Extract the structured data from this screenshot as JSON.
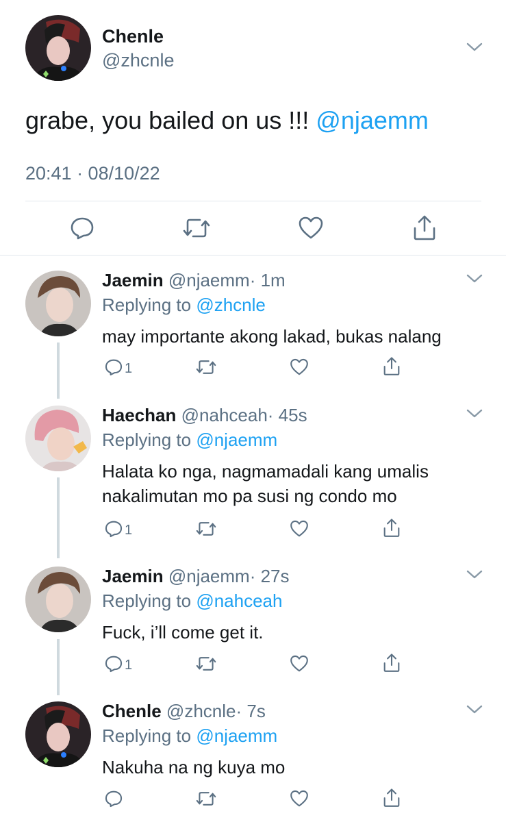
{
  "main_tweet": {
    "name": "Chenle",
    "handle": "@zhcnle",
    "text": "grabe, you bailed on us !!!",
    "mention": "@njaemm",
    "timestamp": "20:41 · 08/10/22"
  },
  "replies": [
    {
      "name": "Jaemin",
      "handle": "@njaemm",
      "time": "· 1m",
      "replying_prefix": "Replying to",
      "replying_to": "@zhcnle",
      "text_lines": [
        "may importante akong lakad, bukas nalang"
      ],
      "reply_count": "1"
    },
    {
      "name": "Haechan",
      "handle": "@nahceah",
      "time": "· 45s",
      "replying_prefix": "Replying to",
      "replying_to": "@njaemm",
      "text_lines": [
        "Halata ko nga, nagmamadali kang umalis",
        "nakalimutan mo pa susi ng condo mo"
      ],
      "reply_count": "1"
    },
    {
      "name": "Jaemin",
      "handle": "@njaemm",
      "time": "· 27s",
      "replying_prefix": "Replying to",
      "replying_to": "@nahceah",
      "text_lines": [
        "Fuck, i’ll come get it."
      ],
      "reply_count": "1"
    },
    {
      "name": "Chenle",
      "handle": "@zhcnle",
      "time": "· 7s",
      "replying_prefix": "Replying to",
      "replying_to": "@njaemm",
      "text_lines": [
        "Nakuha na ng kuya mo"
      ],
      "reply_count": ""
    }
  ],
  "colors": {
    "accent": "#1da1f2",
    "secondary_text": "#5b7083",
    "divider": "#e1e8ed"
  },
  "icons": [
    "chevron-down-icon",
    "reply-icon",
    "retweet-icon",
    "like-icon",
    "share-icon"
  ]
}
